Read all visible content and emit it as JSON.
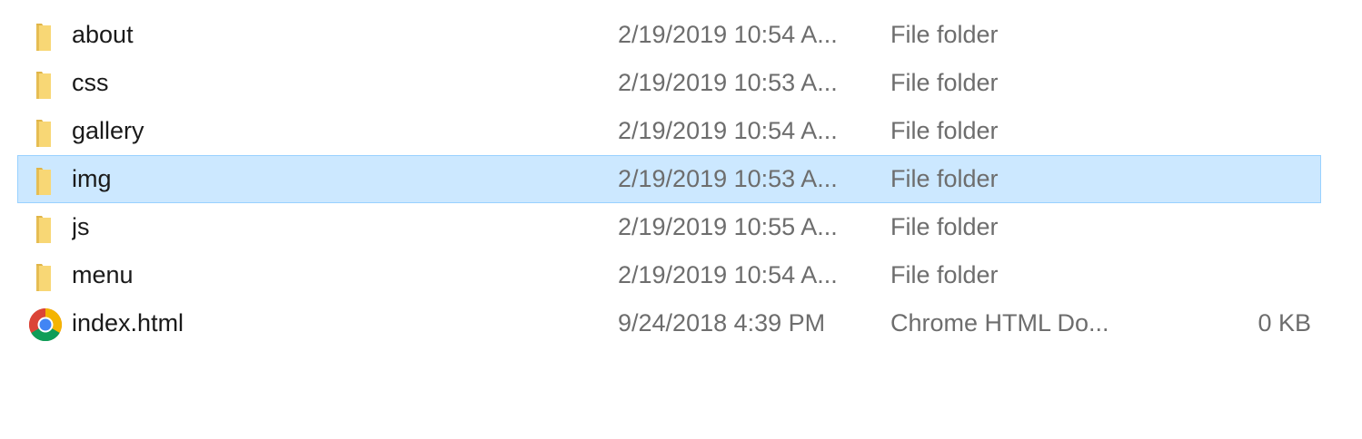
{
  "files": [
    {
      "name": "about",
      "date": "2/19/2019 10:54 A...",
      "type": "File folder",
      "size": "",
      "icon": "folder-icon",
      "selected": false
    },
    {
      "name": "css",
      "date": "2/19/2019 10:53 A...",
      "type": "File folder",
      "size": "",
      "icon": "folder-icon",
      "selected": false
    },
    {
      "name": "gallery",
      "date": "2/19/2019 10:54 A...",
      "type": "File folder",
      "size": "",
      "icon": "folder-icon",
      "selected": false
    },
    {
      "name": "img",
      "date": "2/19/2019 10:53 A...",
      "type": "File folder",
      "size": "",
      "icon": "folder-icon",
      "selected": true
    },
    {
      "name": "js",
      "date": "2/19/2019 10:55 A...",
      "type": "File folder",
      "size": "",
      "icon": "folder-icon",
      "selected": false
    },
    {
      "name": "menu",
      "date": "2/19/2019 10:54 A...",
      "type": "File folder",
      "size": "",
      "icon": "folder-icon",
      "selected": false
    },
    {
      "name": "index.html",
      "date": "9/24/2018 4:39 PM",
      "type": "Chrome HTML Do...",
      "size": "0 KB",
      "icon": "chrome-icon",
      "selected": false
    }
  ],
  "colors": {
    "selection_bg": "#cce8ff",
    "selection_border": "#99d1ff",
    "folder_yellow": "#f8d775"
  }
}
